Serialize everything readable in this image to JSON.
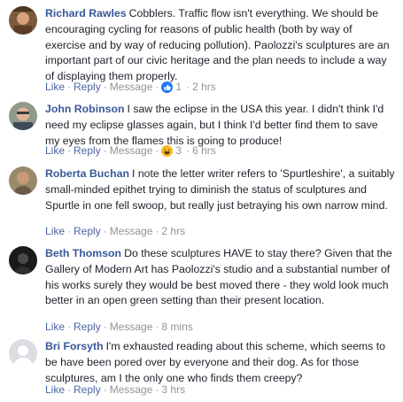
{
  "separator": "·",
  "comments": [
    {
      "author": "Richard Rawles",
      "text": "Cobblers. Traffic flow isn't everything. We should be encouraging cycling for reasons of public health (both by way of exercise and by way of reducing pollution). Paolozzi's sculptures are an important part of our civic heritage and the plan needs to include a way of displaying them properly.",
      "like": "Like",
      "reply": "Reply",
      "message": "Message",
      "reaction_icon": "like-thumb-icon",
      "reaction_count": "1",
      "time": "2 hrs"
    },
    {
      "author": "John Robinson",
      "text": "I saw the eclipse in the USA this year. I didn't think I'd need my eclipse glasses again, but I think I'd better find them to save my eyes from the flames this is going to produce!",
      "like": "Like",
      "reply": "Reply",
      "message": "Message",
      "reaction_icon": "haha-laugh-icon",
      "reaction_count": "3",
      "time": "6 hrs"
    },
    {
      "author": "Roberta Buchan",
      "text": "I note the letter writer refers to 'Spurtleshire', a suitably small-minded epithet trying to diminish the status of sculptures and Spurtle in one fell swoop, but really just betraying his own narrow mind.",
      "like": "Like",
      "reply": "Reply",
      "message": "Message",
      "time": "2 hrs"
    },
    {
      "author": "Beth Thomson",
      "text": "Do these sculptures HAVE to stay there? Given that the Gallery of Modern Art has Paolozzi's studio and a substantial number of his works surely they would be best moved there - they wold look much better in an open green setting than their present location.",
      "like": "Like",
      "reply": "Reply",
      "message": "Message",
      "time": "8 mins"
    },
    {
      "author": "Bri Forsyth",
      "text": "I'm exhausted reading about this scheme, which seems to be have been pored over by everyone and their dog. As for those sculptures, am I the only one who finds them creepy?",
      "like": "Like",
      "reply": "Reply",
      "message": "Message",
      "time": "3 hrs"
    }
  ],
  "colors": {
    "author": "#385898",
    "action_link": "#4b67a1",
    "meta": "#90949c",
    "text": "#1d2129",
    "like_reaction": "#2078f4",
    "haha_reaction": "#f7b928"
  }
}
